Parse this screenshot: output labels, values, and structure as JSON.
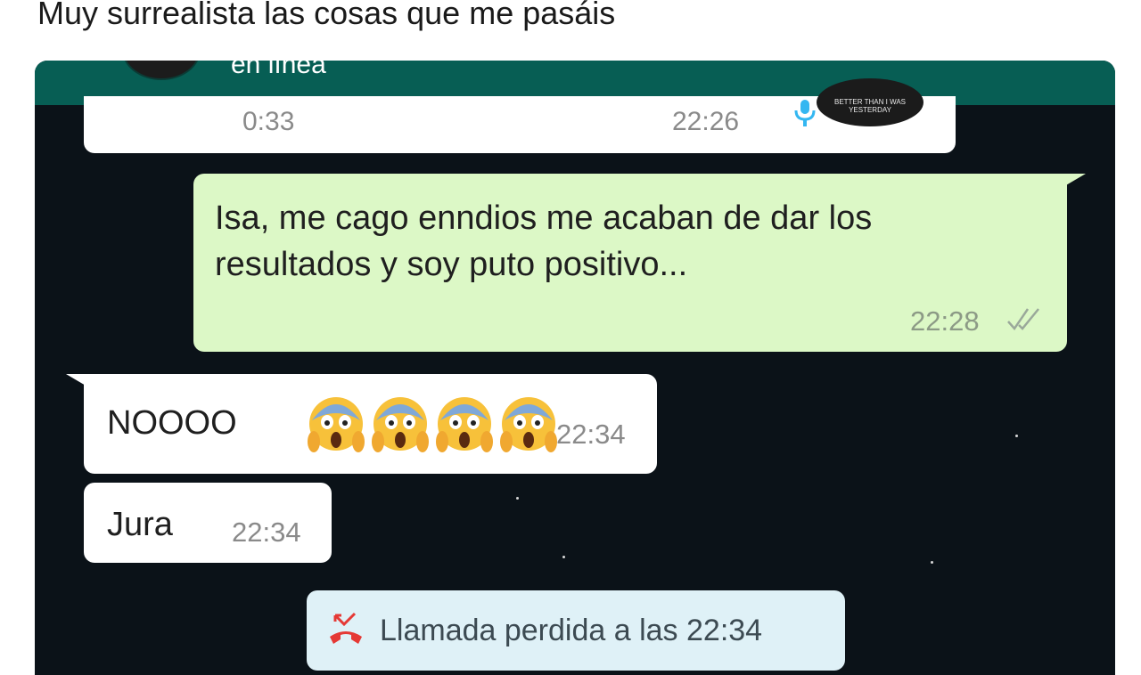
{
  "tweet": {
    "text": "Muy surrealista las cosas que me pasáis"
  },
  "chat": {
    "header": {
      "status": "en línea",
      "avatar_icon": "profile-avatar-icon"
    },
    "audio_message": {
      "duration": "0:33",
      "time": "22:26",
      "mic_icon": "microphone-icon",
      "avatar_text": "BETTER THAN I WAS YESTERDAY"
    },
    "sent_message": {
      "text": "Isa, me cago enndios me acaban de dar los resultados y soy puto positivo...",
      "time": "22:28",
      "status_icon": "double-check-icon"
    },
    "received_1": {
      "text": "NOOOO",
      "emoji_icon": "face-screaming-in-fear-icon",
      "emoji_count": 4,
      "time": "22:34"
    },
    "received_2": {
      "text": "Jura",
      "time": "22:34"
    },
    "missed_call": {
      "text": "Llamada perdida a las 22:34",
      "icon": "missed-call-icon"
    }
  },
  "colors": {
    "header": "#075e54",
    "background": "#0b1218",
    "incoming_bubble": "#ffffff",
    "outgoing_bubble": "#dcf8c6",
    "system_bubble": "#dff1f7",
    "missed_call_icon": "#e53935",
    "mic_icon": "#34b7f1"
  }
}
